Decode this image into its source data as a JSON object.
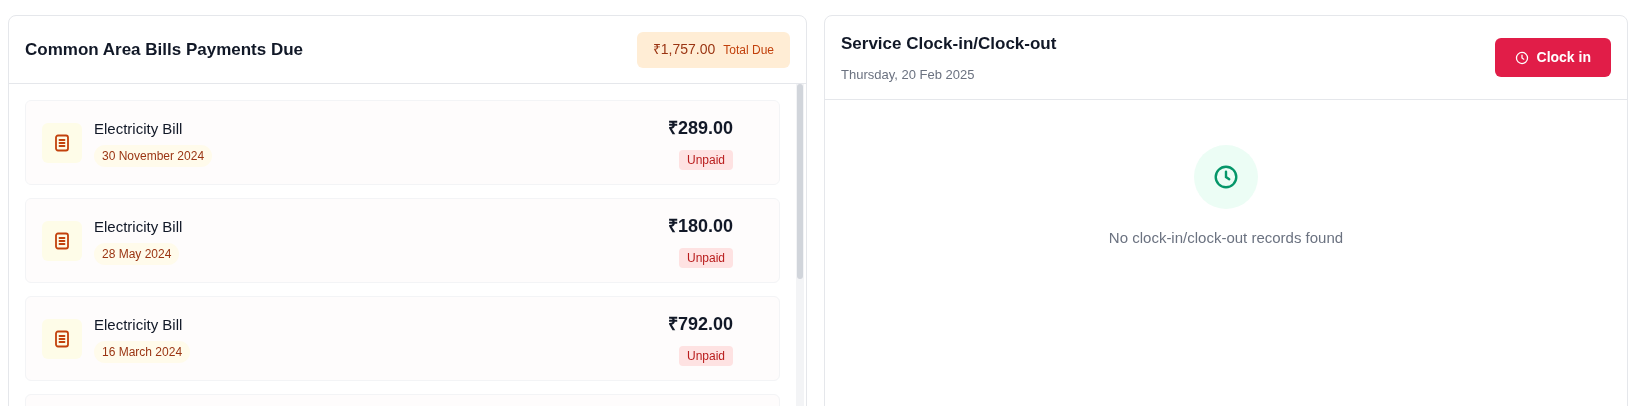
{
  "bills_panel": {
    "title": "Common Area Bills Payments Due",
    "total": {
      "amount": "₹1,757.00",
      "label": "Total Due"
    },
    "bills": [
      {
        "name": "Electricity Bill",
        "date": "30 November 2024",
        "amount": "₹289.00",
        "status": "Unpaid"
      },
      {
        "name": "Electricity Bill",
        "date": "28 May 2024",
        "amount": "₹180.00",
        "status": "Unpaid"
      },
      {
        "name": "Electricity Bill",
        "date": "16 March 2024",
        "amount": "₹792.00",
        "status": "Unpaid"
      }
    ]
  },
  "clock_panel": {
    "title": "Service Clock-in/Clock-out",
    "date": "Thursday, 20 Feb 2025",
    "button": "Clock in",
    "empty_message": "No clock-in/clock-out records found"
  }
}
